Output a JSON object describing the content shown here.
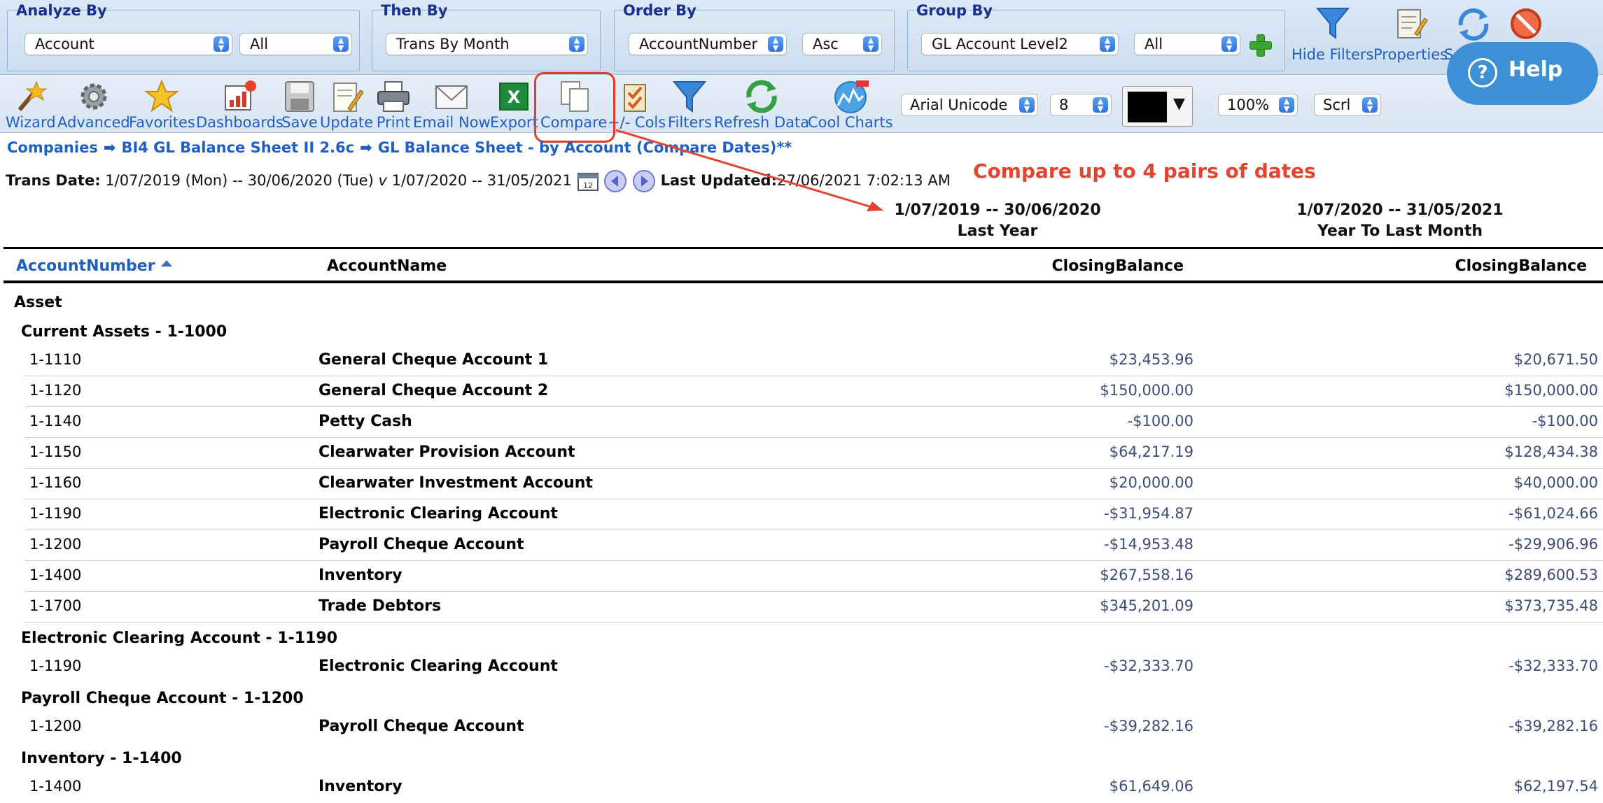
{
  "filters": {
    "analyze_by": {
      "title": "Analyze By",
      "value": "Account",
      "value2": "All"
    },
    "then_by": {
      "title": "Then By",
      "value": "Trans By Month"
    },
    "order_by": {
      "title": "Order By",
      "value": "AccountNumber",
      "value2": "Asc"
    },
    "group_by": {
      "title": "Group By",
      "value": "GL Account Level2",
      "value2": "All"
    }
  },
  "top_buttons": {
    "hide_filters": "Hide Filters",
    "properties": "Properties",
    "s_partial": "S"
  },
  "help": {
    "label": "Help"
  },
  "toolbar": {
    "wizard": "Wizard",
    "advanced": "Advanced",
    "favorites": "Favorites",
    "dashboards": "Dashboards",
    "save": "Save",
    "update": "Update",
    "print": "Print",
    "email_now": "Email Now",
    "export": "Export",
    "compare": "Compare",
    "cols": "+/- Cols",
    "filters": "Filters",
    "refresh_data": "Refresh Data",
    "cool_charts": "Cool Charts",
    "font": "Arial Unicode",
    "font_size": "8",
    "zoom": "100%",
    "scroll": "Scrl"
  },
  "breadcrumb": {
    "item1": "Companies",
    "item2": "BI4 GL Balance Sheet II 2.6c",
    "item3": "GL Balance Sheet - by Account (Compare Dates)**"
  },
  "info": {
    "trans_date_label": "Trans Date:",
    "trans_date_value": "1/07/2019 (Mon) -- 30/06/2020 (Tue)",
    "v": "v",
    "compare_value": "1/07/2020 -- 31/05/2021",
    "last_updated_label": "Last Updated:",
    "last_updated_value": "27/06/2021 7:02:13 AM"
  },
  "annotation": "Compare up to 4 pairs of dates",
  "report": {
    "period1": {
      "range": "1/07/2019 -- 30/06/2020",
      "label": "Last Year"
    },
    "period2": {
      "range": "1/07/2020 -- 31/05/2021",
      "label": "Year To Last Month"
    },
    "columns": {
      "account_number": "AccountNumber",
      "account_name": "AccountName",
      "closing1": "ClosingBalance",
      "closing2": "ClosingBalance"
    },
    "top_group": "Asset",
    "groups": [
      {
        "title": "Current Assets - 1-1000",
        "rows": [
          {
            "acc": "1-1110",
            "name": "General Cheque Account 1",
            "v1": "$23,453.96",
            "v2": "$20,671.50"
          },
          {
            "acc": "1-1120",
            "name": "General Cheque Account 2",
            "v1": "$150,000.00",
            "v2": "$150,000.00"
          },
          {
            "acc": "1-1140",
            "name": "Petty Cash",
            "v1": "-$100.00",
            "v2": "-$100.00"
          },
          {
            "acc": "1-1150",
            "name": "Clearwater Provision Account",
            "v1": "$64,217.19",
            "v2": "$128,434.38"
          },
          {
            "acc": "1-1160",
            "name": "Clearwater Investment Account",
            "v1": "$20,000.00",
            "v2": "$40,000.00"
          },
          {
            "acc": "1-1190",
            "name": "Electronic Clearing Account",
            "v1": "-$31,954.87",
            "v2": "-$61,024.66"
          },
          {
            "acc": "1-1200",
            "name": "Payroll Cheque Account",
            "v1": "-$14,953.48",
            "v2": "-$29,906.96"
          },
          {
            "acc": "1-1400",
            "name": "Inventory",
            "v1": "$267,558.16",
            "v2": "$289,600.53"
          },
          {
            "acc": "1-1700",
            "name": "Trade Debtors",
            "v1": "$345,201.09",
            "v2": "$373,735.48"
          }
        ]
      },
      {
        "title": "Electronic Clearing Account - 1-1190",
        "rows": [
          {
            "acc": "1-1190",
            "name": "Electronic Clearing Account",
            "v1": "-$32,333.70",
            "v2": "-$32,333.70"
          }
        ]
      },
      {
        "title": "Payroll Cheque Account - 1-1200",
        "rows": [
          {
            "acc": "1-1200",
            "name": "Payroll Cheque Account",
            "v1": "-$39,282.16",
            "v2": "-$39,282.16"
          }
        ]
      },
      {
        "title": "Inventory - 1-1400",
        "rows": [
          {
            "acc": "1-1400",
            "name": "Inventory",
            "v1": "$61,649.06",
            "v2": "$62,197.54"
          }
        ]
      }
    ]
  }
}
